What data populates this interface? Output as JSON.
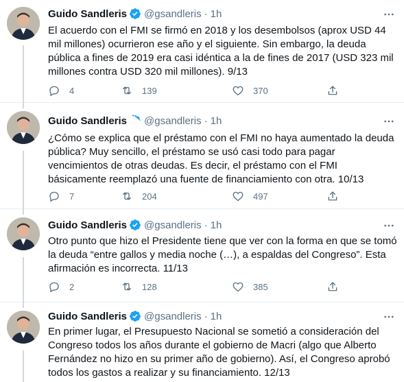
{
  "author": {
    "name": "Guido Sandleris",
    "handle": "@gsandleris",
    "separator": "·"
  },
  "tweets": [
    {
      "time": "1h",
      "text": "El acuerdo con el FMI se firmó en 2018 y los desembolsos (aprox USD 44 mil millones) ocurrieron ese año y el siguiente. Sin embargo, la deuda pública a fines de 2019 era casi idéntica a la de fines de 2017 (USD 323 mil millones contra USD 320 mil millones). 9/13",
      "replies": "4",
      "retweets": "139",
      "likes": "370"
    },
    {
      "time": "1h",
      "text": "¿Cómo se explica que el préstamo con el FMI no haya aumentado la deuda pública? Muy sencillo, el préstamo se usó casi todo para pagar vencimientos de otras deudas. Es decir, el préstamo con el FMI básicamente reemplazó una fuente de financiamiento con otra. 10/13",
      "replies": "7",
      "retweets": "204",
      "likes": "497"
    },
    {
      "time": "1h",
      "text": "Otro punto que hizo el Presidente tiene que ver con la forma en que se tomó la deuda “entre gallos y media noche (…), a espaldas del Congreso”. Esta afirmación es incorrecta. 11/13",
      "replies": "2",
      "retweets": "128",
      "likes": "385"
    },
    {
      "time": "1h",
      "text": "En primer lugar, el Presupuesto Nacional se sometió a consideración del Congreso todos los años durante el gobierno de Macri (algo que Alberto Fernández no hizo en su primer año de gobierno). Así, el Congreso aprobó todos los gastos a realizar y su financiamiento. 12/13"
    }
  ],
  "icons": {
    "reply": "reply-icon",
    "retweet": "retweet-icon",
    "like": "heart-icon",
    "share": "share-icon",
    "more": "more-options-icon",
    "verified": "verified-badge-icon"
  },
  "colors": {
    "text": "#0f1419",
    "secondary": "#5b7083",
    "verified": "#1da1f2",
    "divider": "#e6ecf0"
  }
}
